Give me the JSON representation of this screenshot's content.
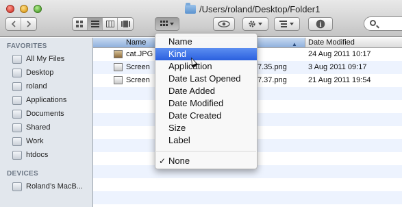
{
  "window": {
    "path": "/Users/roland/Desktop/Folder1"
  },
  "toolbar": {
    "back_icon": "chevron-left-icon",
    "forward_icon": "chevron-right-icon",
    "view_buttons": [
      "icon-view",
      "list-view",
      "column-view",
      "cover-flow-view"
    ],
    "arrange_icon": "arrange-grid-icon",
    "quicklook_icon": "eye-icon",
    "action_icon": "gear-icon",
    "share_icon": "share-list-icon",
    "info_icon": "info-icon",
    "search_icon": "search-icon"
  },
  "sidebar": {
    "favorites_header": "FAVORITES",
    "favorites": [
      {
        "label": "All My Files"
      },
      {
        "label": "Desktop"
      },
      {
        "label": "roland"
      },
      {
        "label": "Applications"
      },
      {
        "label": "Documents"
      },
      {
        "label": "Shared"
      },
      {
        "label": "Work"
      },
      {
        "label": "htdocs"
      }
    ],
    "devices_header": "DEVICES",
    "devices": [
      {
        "label": "Roland’s MacB..."
      }
    ]
  },
  "columns": {
    "name": "Name",
    "date_modified": "Date Modified"
  },
  "files": [
    {
      "name": "cat.JPG",
      "tail": "",
      "date": "24 Aug 2011 10:17"
    },
    {
      "name": "Screen",
      "tail": "7.35.png",
      "date": "3 Aug 2011 09:17"
    },
    {
      "name": "Screen",
      "tail": "7.37.png",
      "date": "21 Aug 2011 19:54"
    }
  ],
  "arrange_menu": {
    "items": [
      "Name",
      "Kind",
      "Application",
      "Date Last Opened",
      "Date Added",
      "Date Modified",
      "Date Created",
      "Size",
      "Label"
    ],
    "highlighted": "Kind",
    "none_label": "None",
    "check": "✓"
  }
}
